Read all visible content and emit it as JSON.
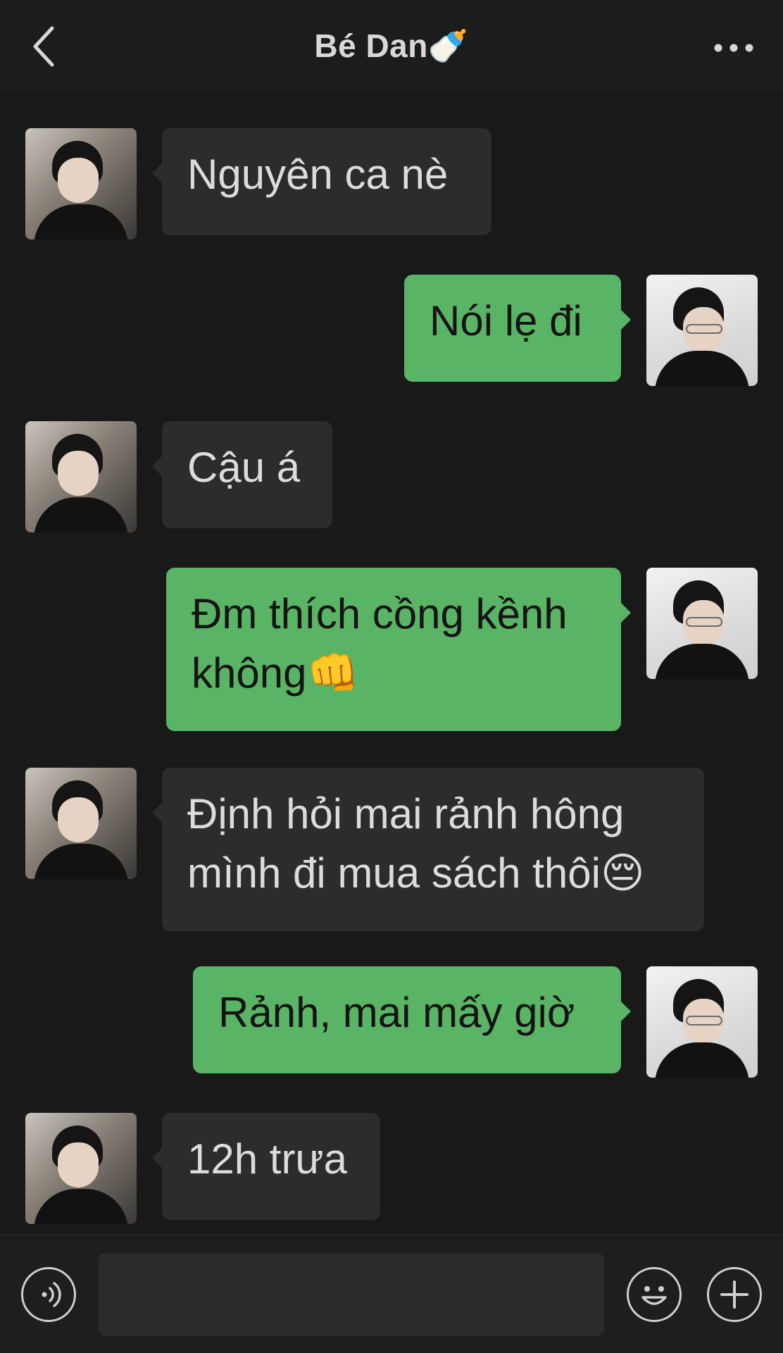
{
  "header": {
    "title": "Bé Dan🍼",
    "back_icon": "chevron-left-icon",
    "more_icon": "more-horizontal-icon"
  },
  "messages": [
    {
      "sender": "friend",
      "text": "Nguyên ca nè"
    },
    {
      "sender": "me",
      "text": "Nói lẹ đi"
    },
    {
      "sender": "friend",
      "text": "Cậu á"
    },
    {
      "sender": "me",
      "text": "Đm thích cồng kềnh\nkhông👊"
    },
    {
      "sender": "friend",
      "text": "Định hỏi mai rảnh hông\nmình đi mua sách thôi😔"
    },
    {
      "sender": "me",
      "text": "Rảnh, mai mấy giờ"
    },
    {
      "sender": "friend",
      "text": "12h trưa"
    }
  ],
  "input_bar": {
    "voice_icon": "voice-icon",
    "input_value": "",
    "emoji_icon": "emoji-icon",
    "add_icon": "plus-circle-icon"
  },
  "colors": {
    "background": "#191919",
    "friend_bubble": "#2c2c2c",
    "my_bubble": "#5ab465"
  }
}
